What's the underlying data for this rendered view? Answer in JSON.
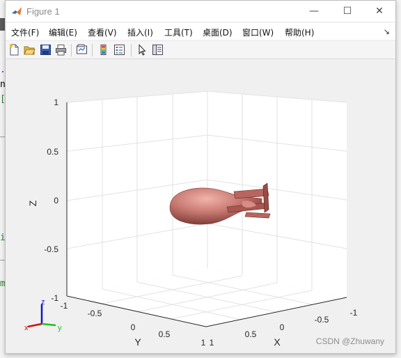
{
  "window": {
    "title": "Figure 1"
  },
  "window_controls": {
    "minimize": "—",
    "maximize": "☐",
    "close": "✕"
  },
  "menu": {
    "items": [
      "文件(F)",
      "编辑(E)",
      "查看(V)",
      "插入(I)",
      "工具(T)",
      "桌面(D)",
      "窗口(W)",
      "帮助(H)"
    ],
    "overflow_arrow": "↘"
  },
  "toolbar": {
    "icons": [
      "new-figure-icon",
      "open-file-icon",
      "save-icon",
      "print-icon",
      "link-plot-icon",
      "insert-colorbar-icon",
      "insert-legend-icon",
      "pointer-icon",
      "property-inspector-icon"
    ]
  },
  "background_fragments": [
    ".",
    "n",
    "[",
    "i",
    "m"
  ],
  "axes": {
    "zlabel": "Z",
    "ylabel": "Y",
    "xlabel": "X",
    "z_ticks": [
      "1",
      "0.5",
      "0",
      "-0.5",
      "-1"
    ],
    "y_ticks": [
      "-1",
      "-0.5",
      "0",
      "0.5",
      "1"
    ],
    "x_ticks": [
      "1",
      "0.5",
      "0",
      "-0.5",
      "-1"
    ],
    "grid": true
  },
  "orientation_triad": {
    "z": "z",
    "x": "x",
    "y": "y"
  },
  "model": {
    "color": "#c87a72",
    "description_kind": "airship"
  },
  "watermark": "CSDN @Zhuwany"
}
